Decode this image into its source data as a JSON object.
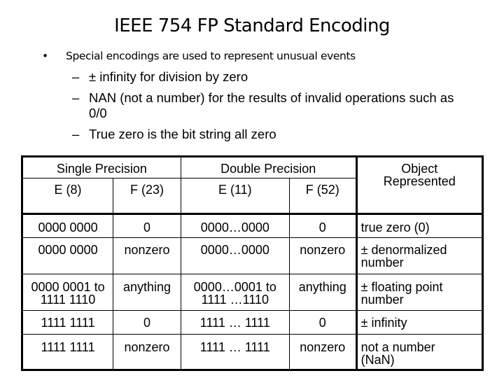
{
  "slide": {
    "title": "IEEE 754 FP Standard Encoding",
    "bullet": "Special encodings are used to represent unusual events",
    "subbullets": [
      "± infinity for division by zero",
      "NAN (not a number) for the results of invalid operations such as",
      "0/0",
      "True zero is the bit string all zero"
    ]
  },
  "table": {
    "group_headers": {
      "single": "Single Precision",
      "double": "Double Precision",
      "object_line1": "Object",
      "object_line2": "Represented"
    },
    "sub_headers": [
      "E (8)",
      "F (23)",
      "E (11)",
      "F (52)"
    ],
    "rows": [
      {
        "se": [
          "0000 0000",
          ""
        ],
        "sf": "0",
        "de": [
          "0000…0000",
          ""
        ],
        "df": "0",
        "obj": [
          "true zero (0)",
          ""
        ]
      },
      {
        "se": [
          "0000 0000",
          ""
        ],
        "sf": "nonzero",
        "de": [
          "0000…0000",
          ""
        ],
        "df": "nonzero",
        "obj": [
          "± denormalized",
          "number"
        ]
      },
      {
        "se": [
          "0000 0001 to",
          "1111 1110"
        ],
        "sf": "anything",
        "de": [
          "0000…0001 to",
          "1111 …1110"
        ],
        "df": "anything",
        "obj": [
          "± floating point",
          "number"
        ]
      },
      {
        "se": [
          "1111 1111",
          ""
        ],
        "sf": "0",
        "de": [
          "1111 … 1111",
          ""
        ],
        "df": "0",
        "obj": [
          "± infinity",
          ""
        ]
      },
      {
        "se": [
          "1111 1111",
          ""
        ],
        "sf": "nonzero",
        "de": [
          "1111 … 1111",
          ""
        ],
        "df": "nonzero",
        "obj": [
          "not a number",
          "(NaN)"
        ]
      }
    ]
  }
}
